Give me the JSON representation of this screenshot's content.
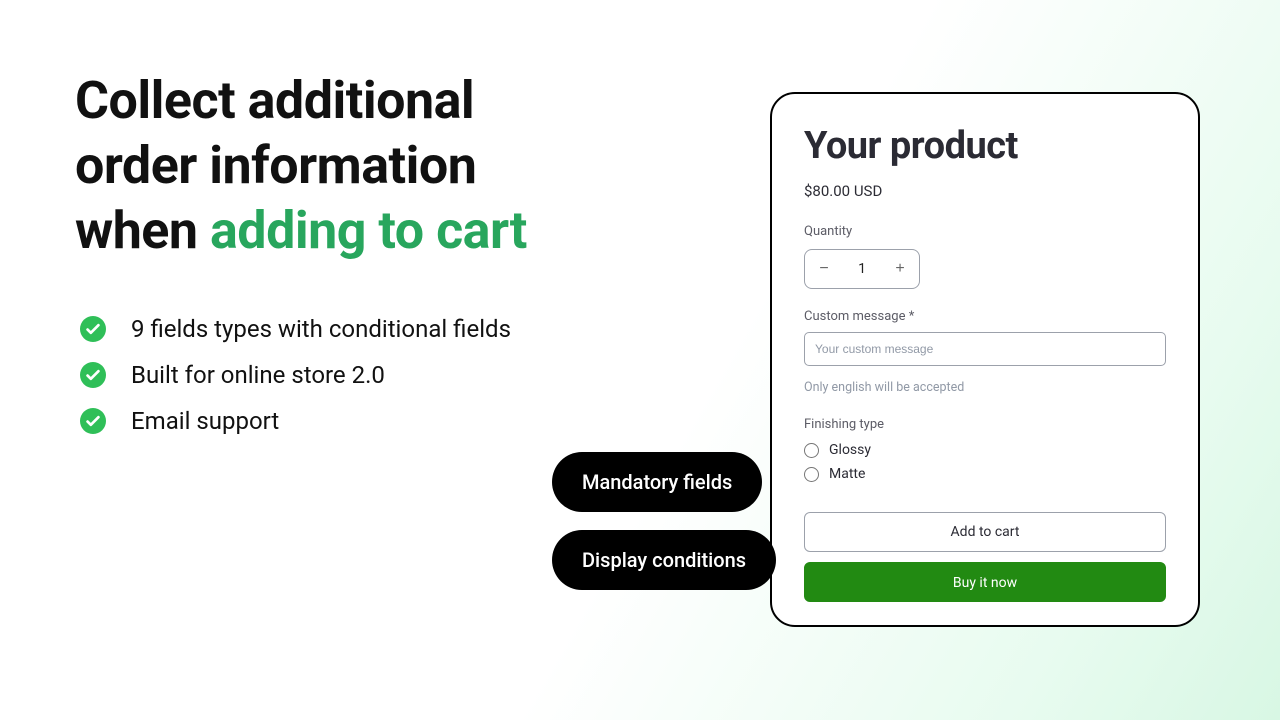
{
  "hero": {
    "line1": "Collect additional",
    "line2": "order information",
    "line3_prefix": "when ",
    "line3_accent": "adding to cart"
  },
  "features": [
    "9 fields types with conditional fields",
    "Built for online store 2.0",
    "Email support"
  ],
  "pills": {
    "mandatory": "Mandatory fields",
    "conditions": "Display conditions"
  },
  "product": {
    "title": "Your product",
    "price": "$80.00 USD",
    "quantity_label": "Quantity",
    "quantity_value": "1",
    "custom_message_label": "Custom message *",
    "custom_message_placeholder": "Your custom message",
    "custom_message_helper": "Only english will be accepted",
    "finishing_label": "Finishing type",
    "finishing_options": {
      "glossy": "Glossy",
      "matte": "Matte"
    },
    "add_to_cart": "Add to cart",
    "buy_now": "Buy it now"
  },
  "colors": {
    "accent_green": "#28a65d",
    "buy_green": "#228a12",
    "black": "#000000"
  }
}
